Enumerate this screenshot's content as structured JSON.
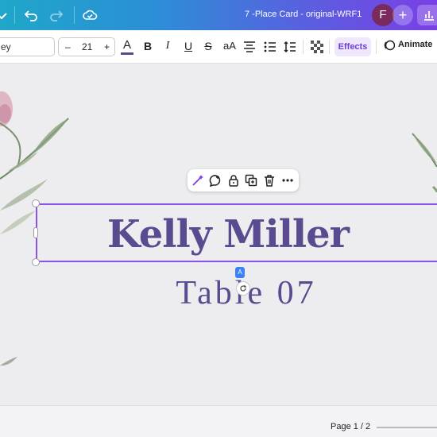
{
  "header": {
    "doc_title": "7 -Place Card - original-WRF1",
    "avatar_initial": "F",
    "add_label": "+"
  },
  "toolbar": {
    "font_name": "ey",
    "font_size": "21",
    "minus": "–",
    "plus": "+",
    "text_color_label": "A",
    "bold": "B",
    "italic": "I",
    "underline": "U",
    "strike": "S",
    "case": "aA",
    "effects_label": "Effects",
    "animate_label": "Animate"
  },
  "canvas": {
    "name_text": "Kelly Miller",
    "table_text": "Table 07",
    "translate_badge": "A"
  },
  "footer": {
    "page_label": "Page 1 / 2"
  },
  "colors": {
    "text_purple": "#5a4a8f",
    "selection": "#8a52e6",
    "header_gradient_start": "#1fa7c9",
    "header_gradient_end": "#7a3fe6",
    "effects_bg": "#efe7fc"
  }
}
